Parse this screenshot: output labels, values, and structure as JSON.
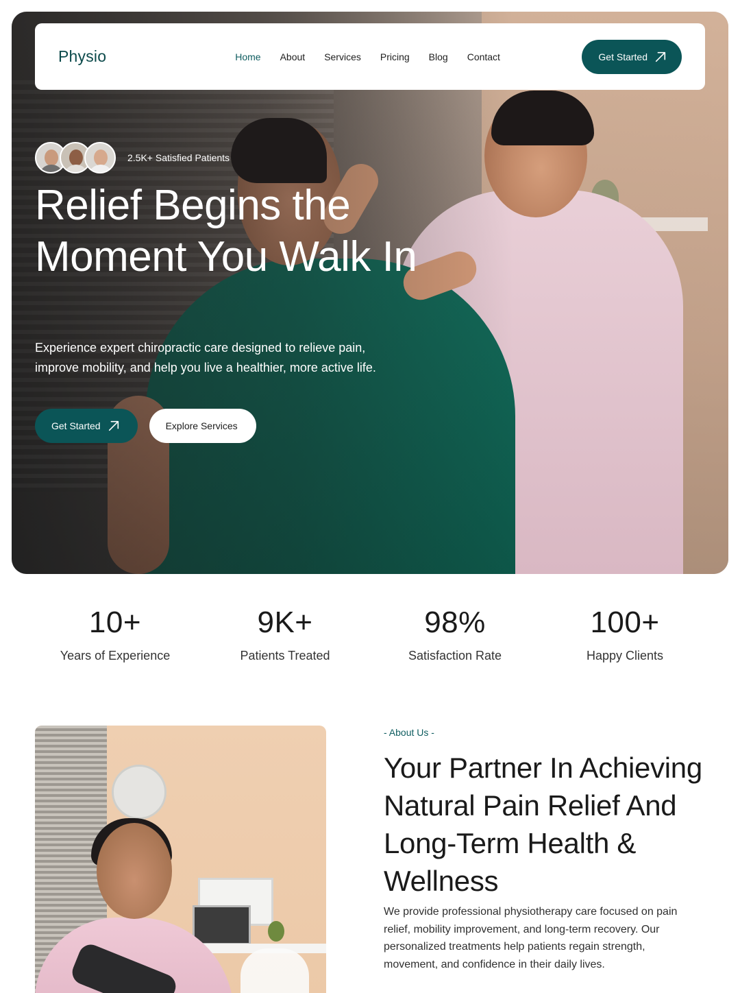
{
  "header": {
    "brand": "Physio",
    "nav": [
      {
        "label": "Home",
        "active": true
      },
      {
        "label": "About",
        "active": false
      },
      {
        "label": "Services",
        "active": false
      },
      {
        "label": "Pricing",
        "active": false
      },
      {
        "label": "Blog",
        "active": false
      },
      {
        "label": "Contact",
        "active": false
      }
    ],
    "cta_label": "Get Started",
    "cta_icon": "arrow-up-right-icon"
  },
  "hero": {
    "patients_label": "2.5K+ Satisfied Patients",
    "title": "Relief Begins the Moment You Walk In",
    "description": "Experience expert chiropractic care designed to relieve pain, improve mobility, and help you live a healthier, more active life.",
    "primary_button": "Get Started",
    "secondary_button": "Explore Services"
  },
  "stats": [
    {
      "value": "10+",
      "label": "Years of Experience"
    },
    {
      "value": "9K+",
      "label": "Patients Treated"
    },
    {
      "value": "98%",
      "label": "Satisfaction Rate"
    },
    {
      "value": "100+",
      "label": "Happy Clients"
    }
  ],
  "about": {
    "eyebrow": "- About Us -",
    "title": "Your Partner In Achieving Natural Pain Relief And Long-Term Health & Wellness",
    "description": "We provide professional physiotherapy care focused on pain relief, mobility improvement, and long-term recovery. Our personalized treatments help patients regain strength, movement, and confidence in their daily lives."
  },
  "colors": {
    "brand": "#0c4a4b",
    "accent": "#0b5557",
    "active_link": "#0f5d60"
  }
}
